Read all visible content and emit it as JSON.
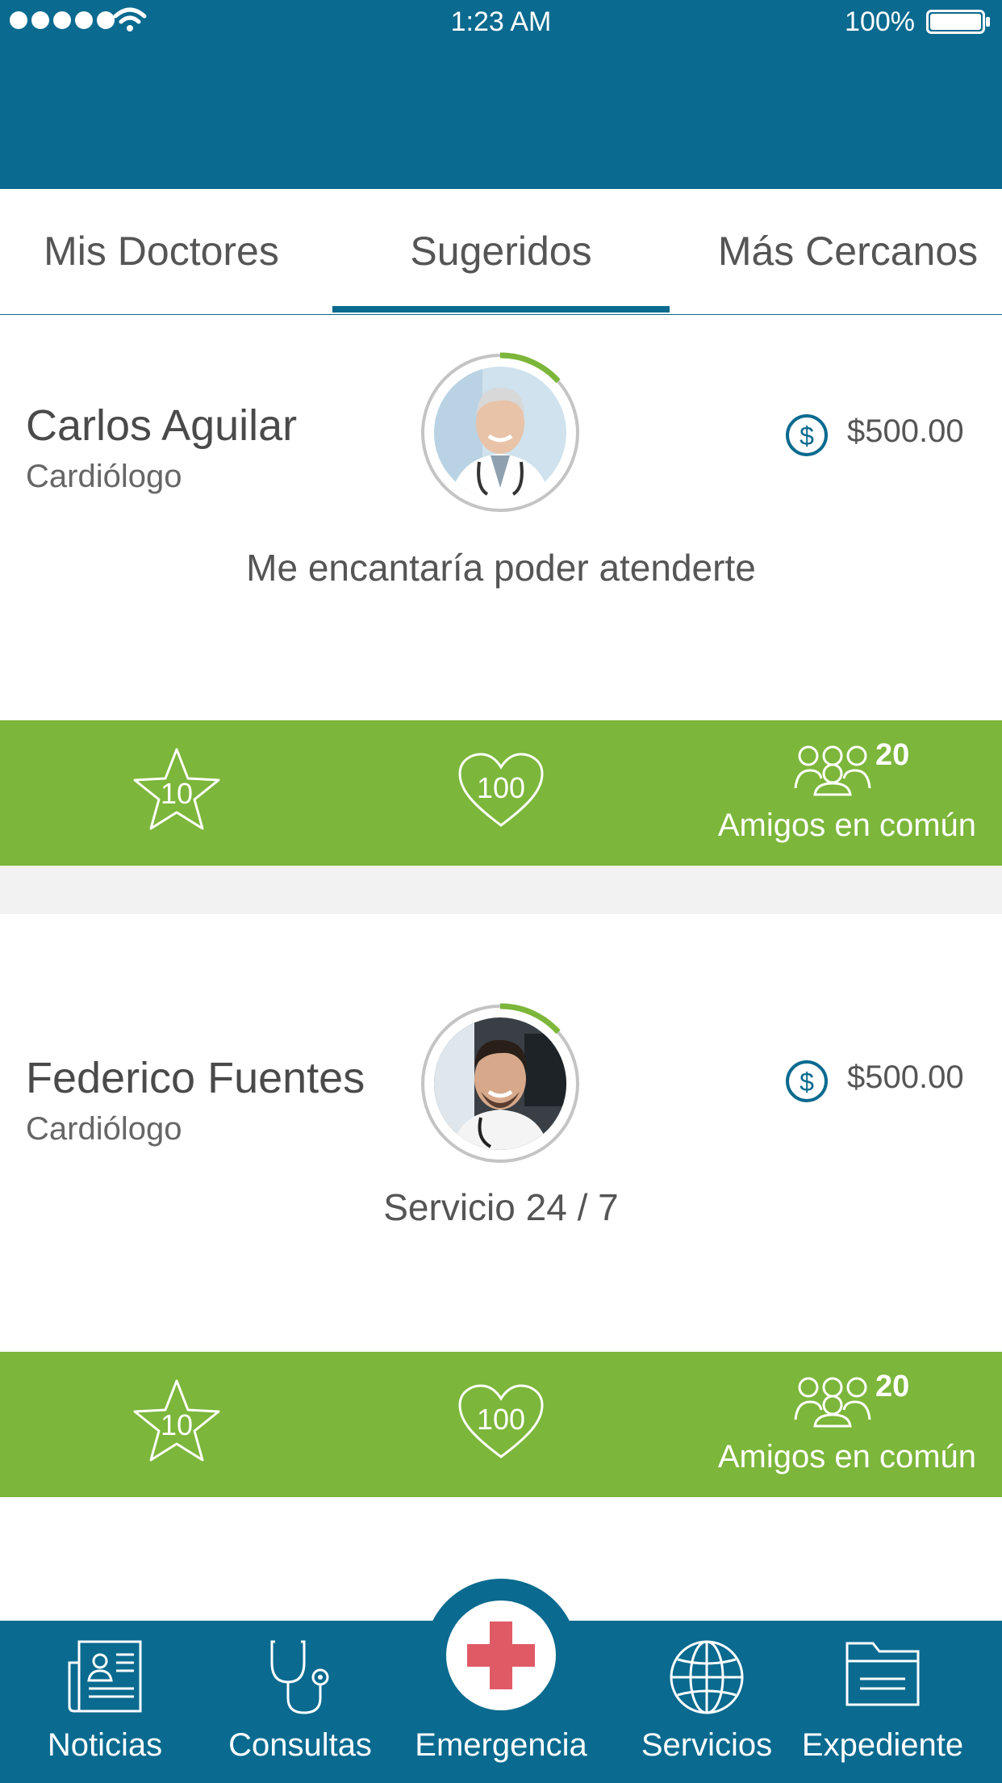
{
  "status_bar": {
    "time": "1:23 AM",
    "battery": "100%"
  },
  "tabs": [
    {
      "label": "Mis Doctores"
    },
    {
      "label": "Sugeridos",
      "active": true
    },
    {
      "label": "Más Cercanos"
    }
  ],
  "doctors": [
    {
      "name": "Carlos Aguilar",
      "specialty": "Cardiólogo",
      "price": "$500.00",
      "tagline": "Me encantaría poder atenderte",
      "rating": "10",
      "likes": "100",
      "friends_count": "20",
      "friends_label": "Amigos en común"
    },
    {
      "name": "Federico Fuentes",
      "specialty": "Cardiólogo",
      "price": "$500.00",
      "tagline": "Servicio 24 / 7",
      "rating": "10",
      "likes": "100",
      "friends_count": "20",
      "friends_label": "Amigos en común"
    }
  ],
  "bottom_nav": [
    {
      "label": "Noticias",
      "icon": "newspaper-icon"
    },
    {
      "label": "Consultas",
      "icon": "stethoscope-icon"
    },
    {
      "label": "Emergencia",
      "icon": "red-cross-icon"
    },
    {
      "label": "Servicios",
      "icon": "globe-icon"
    },
    {
      "label": "Expediente",
      "icon": "folder-icon"
    }
  ],
  "colors": {
    "primary": "#0a6a8f",
    "accent_green": "#7cb63a",
    "emergency_red": "#e05a66"
  }
}
